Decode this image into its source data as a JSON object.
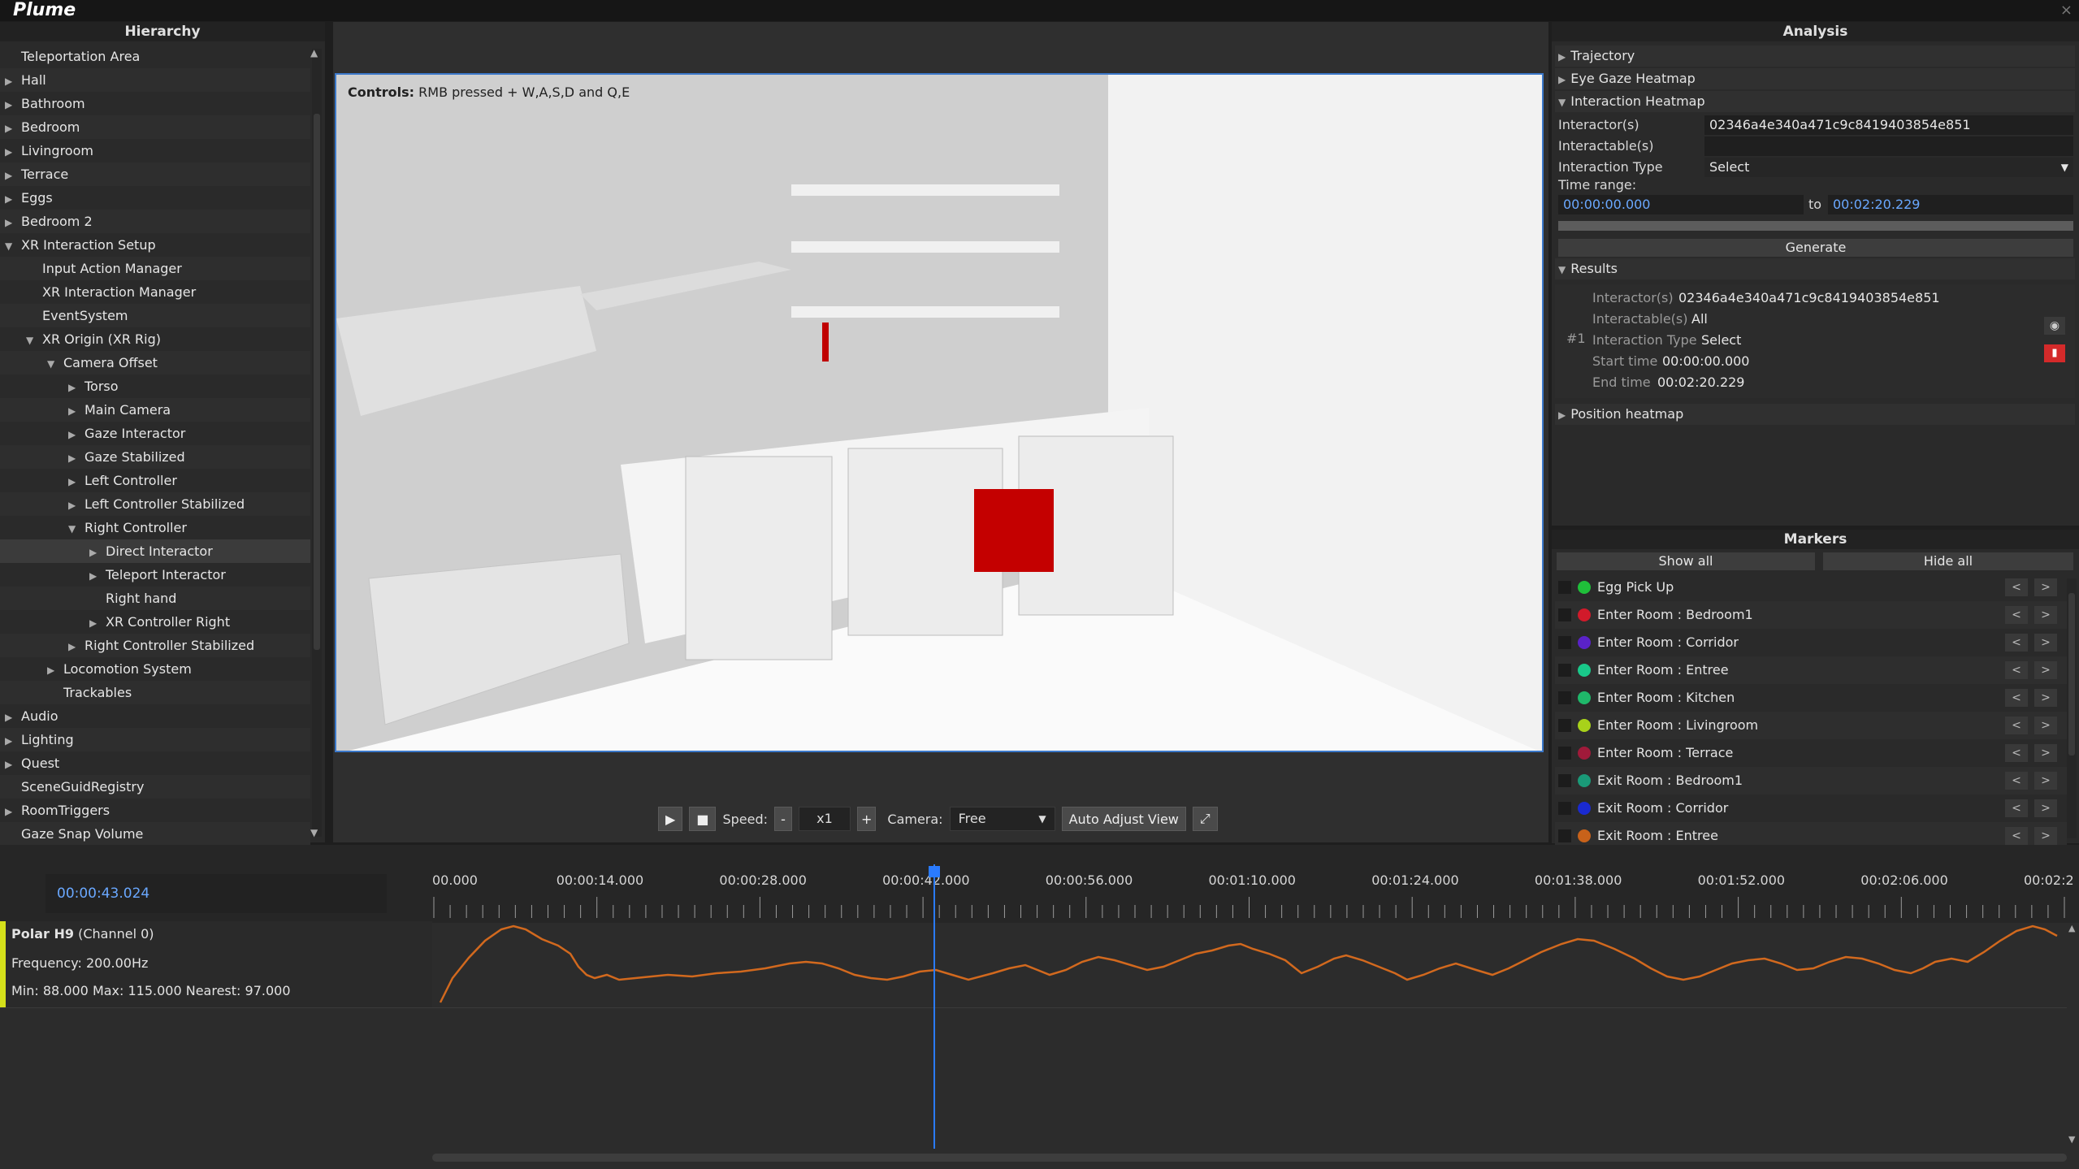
{
  "app": {
    "title": "Plume",
    "close_glyph": "×"
  },
  "hierarchy": {
    "title": "Hierarchy",
    "items": [
      {
        "label": "Teleportation Area",
        "depth": 0,
        "arrow": ""
      },
      {
        "label": "Hall",
        "depth": 0,
        "arrow": "▶"
      },
      {
        "label": "Bathroom",
        "depth": 0,
        "arrow": "▶"
      },
      {
        "label": "Bedroom",
        "depth": 0,
        "arrow": "▶"
      },
      {
        "label": "Livingroom",
        "depth": 0,
        "arrow": "▶"
      },
      {
        "label": "Terrace",
        "depth": 0,
        "arrow": "▶"
      },
      {
        "label": "Eggs",
        "depth": 0,
        "arrow": "▶"
      },
      {
        "label": "Bedroom 2",
        "depth": 0,
        "arrow": "▶"
      },
      {
        "label": "XR Interaction Setup",
        "depth": 0,
        "arrow": "▼"
      },
      {
        "label": "Input Action Manager",
        "depth": 1,
        "arrow": ""
      },
      {
        "label": "XR Interaction Manager",
        "depth": 1,
        "arrow": ""
      },
      {
        "label": "EventSystem",
        "depth": 1,
        "arrow": ""
      },
      {
        "label": "XR Origin (XR Rig)",
        "depth": 1,
        "arrow": "▼"
      },
      {
        "label": "Camera Offset",
        "depth": 2,
        "arrow": "▼"
      },
      {
        "label": "Torso",
        "depth": 3,
        "arrow": "▶"
      },
      {
        "label": "Main Camera",
        "depth": 3,
        "arrow": "▶"
      },
      {
        "label": "Gaze Interactor",
        "depth": 3,
        "arrow": "▶"
      },
      {
        "label": "Gaze Stabilized",
        "depth": 3,
        "arrow": "▶"
      },
      {
        "label": "Left Controller",
        "depth": 3,
        "arrow": "▶"
      },
      {
        "label": "Left Controller Stabilized",
        "depth": 3,
        "arrow": "▶"
      },
      {
        "label": "Right Controller",
        "depth": 3,
        "arrow": "▼"
      },
      {
        "label": "Direct Interactor",
        "depth": 4,
        "arrow": "▶"
      },
      {
        "label": "Teleport Interactor",
        "depth": 4,
        "arrow": "▶"
      },
      {
        "label": "Right hand",
        "depth": 4,
        "arrow": ""
      },
      {
        "label": "XR Controller Right",
        "depth": 4,
        "arrow": "▶"
      },
      {
        "label": "Right Controller Stabilized",
        "depth": 3,
        "arrow": "▶"
      },
      {
        "label": "Locomotion System",
        "depth": 2,
        "arrow": "▶"
      },
      {
        "label": "Trackables",
        "depth": 2,
        "arrow": ""
      },
      {
        "label": "Audio",
        "depth": 0,
        "arrow": "▶"
      },
      {
        "label": "Lighting",
        "depth": 0,
        "arrow": "▶"
      },
      {
        "label": "Quest",
        "depth": 0,
        "arrow": "▶"
      },
      {
        "label": "SceneGuidRegistry",
        "depth": 0,
        "arrow": ""
      },
      {
        "label": "RoomTriggers",
        "depth": 0,
        "arrow": "▶"
      },
      {
        "label": "Gaze Snap Volume",
        "depth": 0,
        "arrow": ""
      }
    ]
  },
  "viewport": {
    "controls_label": "Controls:",
    "controls_text": "RMB pressed + W,A,S,D and Q,E",
    "toolbar": {
      "speed_label": "Speed:",
      "speed_minus": "-",
      "speed_value": "x1",
      "speed_plus": "+",
      "camera_label": "Camera:",
      "camera_value": "Free",
      "auto_adjust": "Auto Adjust View"
    }
  },
  "analysis": {
    "title": "Analysis",
    "sections": {
      "trajectory": "Trajectory",
      "eye_gaze": "Eye Gaze Heatmap",
      "interaction": "Interaction Heatmap",
      "results": "Results",
      "position": "Position heatmap"
    },
    "form": {
      "interactors_label": "Interactor(s)",
      "interactors_value": "02346a4e340a471c9c8419403854e851",
      "interactables_label": "Interactable(s)",
      "interactables_value": "",
      "type_label": "Interaction Type",
      "type_value": "Select",
      "time_range_label": "Time range:",
      "time_from": "00:00:00.000",
      "time_to_label": "to",
      "time_to": "00:02:20.229",
      "generate": "Generate"
    },
    "result": {
      "index": "#1",
      "interactors_k": "Interactor(s)",
      "interactors_v": "02346a4e340a471c9c8419403854e851",
      "interactables_k": "Interactable(s)",
      "interactables_v": "All",
      "type_k": "Interaction Type",
      "type_v": "Select",
      "start_k": "Start time",
      "start_v": "00:00:00.000",
      "end_k": "End time",
      "end_v": "00:02:20.229"
    }
  },
  "markers": {
    "title": "Markers",
    "show_all": "Show all",
    "hide_all": "Hide all",
    "items": [
      {
        "label": "Egg Pick Up",
        "color": "#1fbf3a"
      },
      {
        "label": "Enter Room : Bedroom1",
        "color": "#d11a2a"
      },
      {
        "label": "Enter Room : Corridor",
        "color": "#5a22c8"
      },
      {
        "label": "Enter Room : Entree",
        "color": "#19c98a"
      },
      {
        "label": "Enter Room : Kitchen",
        "color": "#1fb86a"
      },
      {
        "label": "Enter Room : Livingroom",
        "color": "#a8d21a"
      },
      {
        "label": "Enter Room : Terrace",
        "color": "#a01a3a"
      },
      {
        "label": "Exit Room : Bedroom1",
        "color": "#1a9a78"
      },
      {
        "label": "Exit Room : Corridor",
        "color": "#1a2ad0"
      },
      {
        "label": "Exit Room : Entree",
        "color": "#c8621a"
      }
    ]
  },
  "timeline": {
    "current_time": "00:00:43.024",
    "ticks": [
      "00.000",
      "00:00:14.000",
      "00:00:28.000",
      "00:00:42.000",
      "00:00:56.000",
      "00:01:10.000",
      "00:01:24.000",
      "00:01:38.000",
      "00:01:52.000",
      "00:02:06.000",
      "00:02:2"
    ],
    "track": {
      "name": "Polar H9",
      "channel": "(Channel 0)",
      "frequency": "Frequency: 200.00Hz",
      "stats": "Min: 88.000 Max: 115.000 Nearest: 97.000",
      "color": "#d4e01a",
      "line_color": "#d2691e",
      "min": 88,
      "max": 115
    }
  }
}
